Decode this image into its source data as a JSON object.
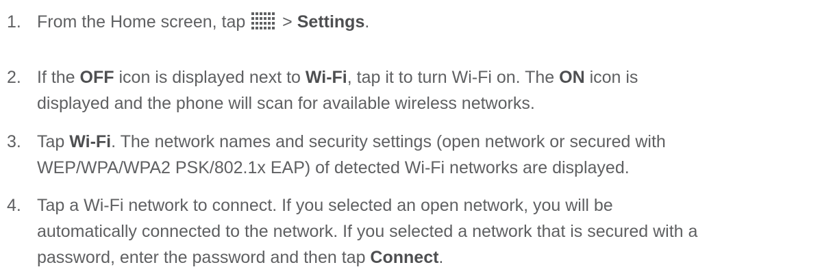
{
  "steps": [
    {
      "number": "1.",
      "parts": {
        "a": "From the Home screen, tap ",
        "b": " > ",
        "c": "Settings",
        "d": "."
      }
    },
    {
      "number": "2.",
      "parts": {
        "a": "If the ",
        "b": "OFF",
        "c": " icon is displayed next to ",
        "d": "Wi-Fi",
        "e": ", tap it to turn Wi-Fi on. The ",
        "f": "ON",
        "g": " icon is",
        "h": "displayed and the phone will scan for available wireless networks."
      }
    },
    {
      "number": "3.",
      "parts": {
        "a": "Tap ",
        "b": "Wi-Fi",
        "c": ". The network names and security settings (open network or secured with",
        "d": "WEP/WPA/WPA2 PSK/802.1x EAP) of detected Wi-Fi networks are displayed."
      }
    },
    {
      "number": "4.",
      "parts": {
        "a": "Tap a Wi-Fi network to connect. If you selected an open network, you will be",
        "b": "automatically connected to the network. If you selected a network that is secured with a",
        "c": "password, enter the password and then tap ",
        "d": "Connect",
        "e": "."
      }
    }
  ],
  "icons": {
    "apps": "apps-grid-icon"
  },
  "colors": {
    "text": "#5f6062",
    "icon": "#5f6062"
  }
}
